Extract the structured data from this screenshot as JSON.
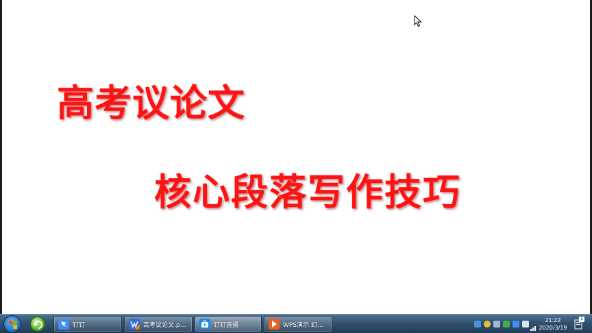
{
  "slide": {
    "title_line_1": "高考议论文",
    "title_line_2": "核心段落写作技巧"
  },
  "taskbar": {
    "start_icon": "windows-start-orb",
    "quick_launch_icon": "refresh-app-icon",
    "buttons": [
      {
        "label": "钉钉",
        "icon": "dingtalk-icon"
      },
      {
        "label": "高考议论文.pptx ...",
        "icon": "wps-presentation-icon"
      },
      {
        "label": "钉钉直播",
        "icon": "live-stream-icon"
      },
      {
        "label": "WPS演示 幻灯片...",
        "icon": "wps-slides-icon"
      }
    ],
    "clock": {
      "time": "21:22",
      "date": "2020/3/19"
    },
    "notification_count": "1"
  },
  "colors": {
    "title_red": "#ff1212",
    "taskbar_top": "#4f7092",
    "taskbar_bottom": "#233d58"
  }
}
